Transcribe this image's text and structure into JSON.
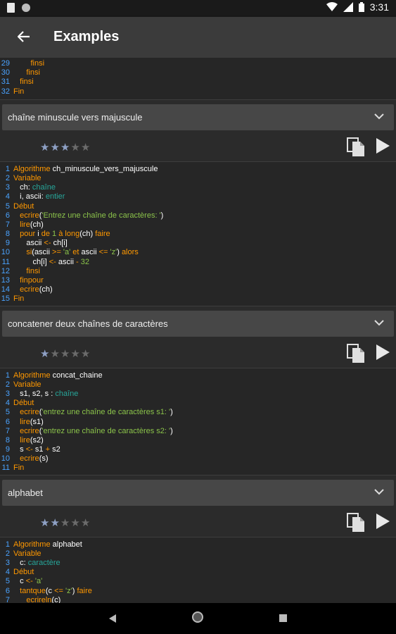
{
  "status": {
    "time": "3:31"
  },
  "appbar": {
    "title": "Examples"
  },
  "colors": {
    "keyword": "#ff9800",
    "type": "#26a69a",
    "string": "#8bc34a",
    "line_number": "#4aa3ff",
    "star_on": "#8ea0c4"
  },
  "top_code": {
    "lines": [
      {
        "n": "29",
        "parts": [
          [
            "kw",
            "        finsi"
          ]
        ]
      },
      {
        "n": "30",
        "parts": [
          [
            "kw",
            "      finsi"
          ]
        ]
      },
      {
        "n": "31",
        "parts": [
          [
            "kw",
            "   finsi"
          ]
        ]
      },
      {
        "n": "32",
        "parts": [
          [
            "kw",
            "Fin"
          ]
        ]
      }
    ]
  },
  "examples": [
    {
      "title": "chaîne minuscule vers majuscule",
      "rating": 3,
      "code": [
        {
          "n": "1",
          "parts": [
            [
              "kw",
              "Algorithme "
            ],
            [
              "nm",
              "ch_minuscule_vers_majuscule"
            ]
          ]
        },
        {
          "n": "2",
          "parts": [
            [
              "kw",
              "Variable"
            ]
          ]
        },
        {
          "n": "3",
          "parts": [
            [
              "nm",
              "   ch"
            ],
            [
              "nm",
              ": "
            ],
            [
              "ty",
              "chaîne"
            ]
          ]
        },
        {
          "n": "4",
          "parts": [
            [
              "nm",
              "   i"
            ],
            [
              "nm",
              ", "
            ],
            [
              "nm",
              "ascii"
            ],
            [
              "nm",
              ": "
            ],
            [
              "ty",
              "entier"
            ]
          ]
        },
        {
          "n": "5",
          "parts": [
            [
              "kw",
              "Début"
            ]
          ]
        },
        {
          "n": "6",
          "parts": [
            [
              "kw",
              "   ecrire"
            ],
            [
              "nm",
              "("
            ],
            [
              "st",
              "'Entrez une chaîne de caractères: '"
            ],
            [
              "nm",
              ")"
            ]
          ]
        },
        {
          "n": "7",
          "parts": [
            [
              "kw",
              "   lire"
            ],
            [
              "nm",
              "("
            ],
            [
              "nm",
              "ch"
            ],
            [
              "nm",
              ")"
            ]
          ]
        },
        {
          "n": "8",
          "parts": [
            [
              "kw",
              "   pour "
            ],
            [
              "nm",
              "i "
            ],
            [
              "kw",
              "de "
            ],
            [
              "st",
              "1 "
            ],
            [
              "kw",
              "à "
            ],
            [
              "kw",
              "long"
            ],
            [
              "nm",
              "("
            ],
            [
              "nm",
              "ch"
            ],
            [
              "nm",
              ") "
            ],
            [
              "kw",
              "faire"
            ]
          ]
        },
        {
          "n": "9",
          "parts": [
            [
              "nm",
              "      ascii "
            ],
            [
              "op",
              "<- "
            ],
            [
              "nm",
              "ch"
            ],
            [
              "nm",
              "[i]"
            ]
          ]
        },
        {
          "n": "10",
          "parts": [
            [
              "kw",
              "      si"
            ],
            [
              "nm",
              "(ascii "
            ],
            [
              "op",
              ">= "
            ],
            [
              "st",
              "'a' "
            ],
            [
              "kw",
              "et "
            ],
            [
              "nm",
              "ascii "
            ],
            [
              "op",
              "<= "
            ],
            [
              "st",
              "'z'"
            ],
            [
              "nm",
              ") "
            ],
            [
              "kw",
              "alors"
            ]
          ]
        },
        {
          "n": "11",
          "parts": [
            [
              "nm",
              "         ch"
            ],
            [
              "nm",
              "[i] "
            ],
            [
              "op",
              "<- "
            ],
            [
              "nm",
              "ascii "
            ],
            [
              "op",
              "- "
            ],
            [
              "st",
              "32"
            ]
          ]
        },
        {
          "n": "12",
          "parts": [
            [
              "kw",
              "      finsi"
            ]
          ]
        },
        {
          "n": "13",
          "parts": [
            [
              "kw",
              "   finpour"
            ]
          ]
        },
        {
          "n": "14",
          "parts": [
            [
              "kw",
              "   ecrire"
            ],
            [
              "nm",
              "("
            ],
            [
              "nm",
              "ch"
            ],
            [
              "nm",
              ")"
            ]
          ]
        },
        {
          "n": "15",
          "parts": [
            [
              "kw",
              "Fin"
            ]
          ]
        }
      ]
    },
    {
      "title": "concatener deux chaînes de caractères",
      "rating": 1,
      "code": [
        {
          "n": "1",
          "parts": [
            [
              "kw",
              "Algorithme "
            ],
            [
              "nm",
              "concat_chaine"
            ]
          ]
        },
        {
          "n": "2",
          "parts": [
            [
              "kw",
              "Variable"
            ]
          ]
        },
        {
          "n": "3",
          "parts": [
            [
              "nm",
              "   s1"
            ],
            [
              "nm",
              ", "
            ],
            [
              "nm",
              "s2"
            ],
            [
              "nm",
              ", "
            ],
            [
              "nm",
              "s "
            ],
            [
              "nm",
              ": "
            ],
            [
              "ty",
              "chaîne"
            ]
          ]
        },
        {
          "n": "4",
          "parts": [
            [
              "kw",
              "Début"
            ]
          ]
        },
        {
          "n": "5",
          "parts": [
            [
              "kw",
              "   ecrire"
            ],
            [
              "nm",
              "("
            ],
            [
              "st",
              "'entrez une chaîne de caractères s1: '"
            ],
            [
              "nm",
              ")"
            ]
          ]
        },
        {
          "n": "6",
          "parts": [
            [
              "kw",
              "   lire"
            ],
            [
              "nm",
              "("
            ],
            [
              "nm",
              "s1"
            ],
            [
              "nm",
              ")"
            ]
          ]
        },
        {
          "n": "7",
          "parts": [
            [
              "kw",
              "   ecrire"
            ],
            [
              "nm",
              "("
            ],
            [
              "st",
              "'entrez une chaîne de caractères s2: '"
            ],
            [
              "nm",
              ")"
            ]
          ]
        },
        {
          "n": "8",
          "parts": [
            [
              "kw",
              "   lire"
            ],
            [
              "nm",
              "("
            ],
            [
              "nm",
              "s2"
            ],
            [
              "nm",
              ")"
            ]
          ]
        },
        {
          "n": "9",
          "parts": [
            [
              "nm",
              "   s "
            ],
            [
              "op",
              "<- "
            ],
            [
              "nm",
              "s1 "
            ],
            [
              "op",
              "+ "
            ],
            [
              "nm",
              "s2"
            ]
          ]
        },
        {
          "n": "10",
          "parts": [
            [
              "kw",
              "   ecrire"
            ],
            [
              "nm",
              "("
            ],
            [
              "nm",
              "s"
            ],
            [
              "nm",
              ")"
            ]
          ]
        },
        {
          "n": "11",
          "parts": [
            [
              "kw",
              "Fin"
            ]
          ]
        }
      ]
    },
    {
      "title": "alphabet",
      "rating": 2,
      "code": [
        {
          "n": "1",
          "parts": [
            [
              "kw",
              "Algorithme "
            ],
            [
              "nm",
              "alphabet"
            ]
          ]
        },
        {
          "n": "2",
          "parts": [
            [
              "kw",
              "Variable"
            ]
          ]
        },
        {
          "n": "3",
          "parts": [
            [
              "nm",
              "   c"
            ],
            [
              "nm",
              ": "
            ],
            [
              "ty",
              "caractère"
            ]
          ]
        },
        {
          "n": "4",
          "parts": [
            [
              "kw",
              "Début"
            ]
          ]
        },
        {
          "n": "5",
          "parts": [
            [
              "nm",
              "   c "
            ],
            [
              "op",
              "<- "
            ],
            [
              "st",
              "'a'"
            ]
          ]
        },
        {
          "n": "6",
          "parts": [
            [
              "kw",
              "   tantque"
            ],
            [
              "nm",
              "("
            ],
            [
              "nm",
              "c "
            ],
            [
              "op",
              "<= "
            ],
            [
              "st",
              "'z'"
            ],
            [
              "nm",
              ") "
            ],
            [
              "kw",
              "faire"
            ]
          ]
        },
        {
          "n": "7",
          "parts": [
            [
              "kw",
              "      ecrireln"
            ],
            [
              "nm",
              "("
            ],
            [
              "nm",
              "c"
            ],
            [
              "nm",
              ")"
            ]
          ]
        }
      ]
    }
  ]
}
